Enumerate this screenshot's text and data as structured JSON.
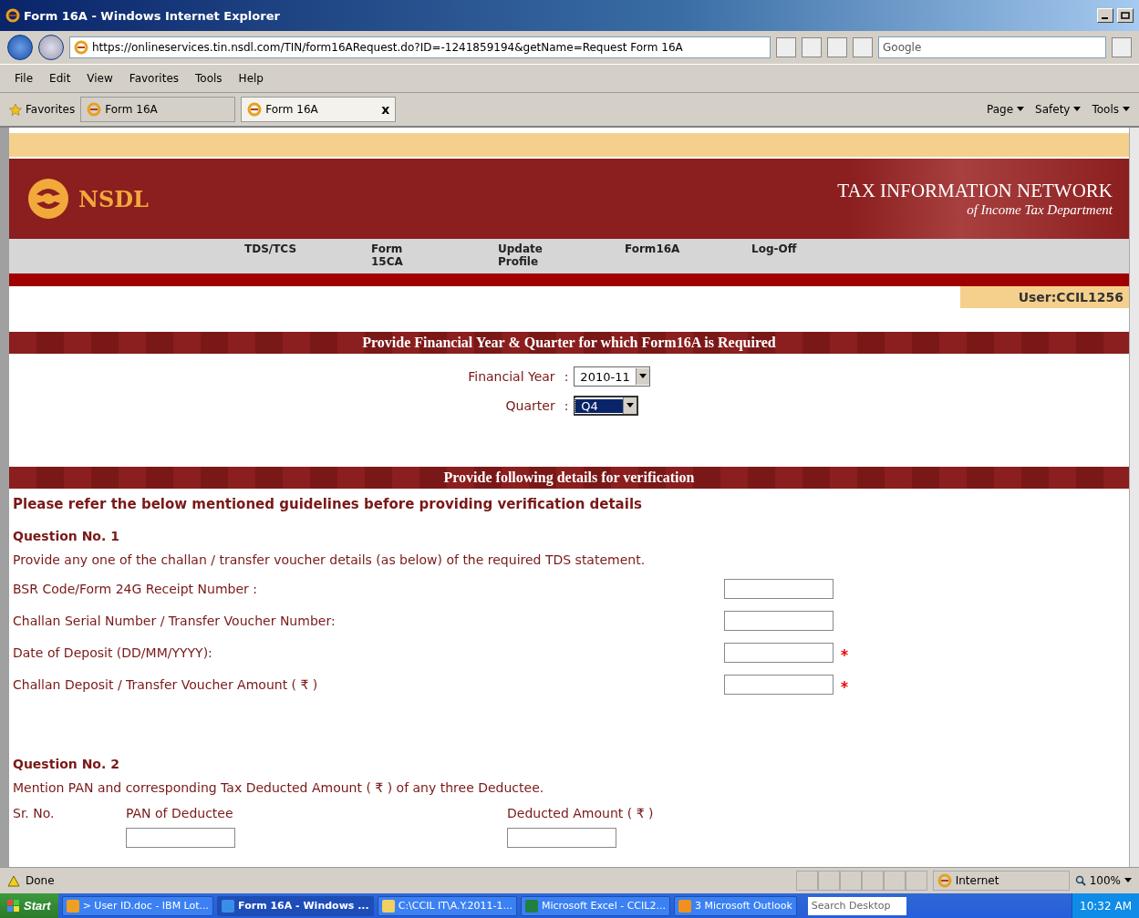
{
  "window": {
    "title": "Form 16A - Windows Internet Explorer"
  },
  "browser": {
    "address": "https://onlineservices.tin.nsdl.com/TIN/form16ARequest.do?ID=-1241859194&getName=Request Form 16A",
    "search_placeholder": "Google",
    "menu": [
      "File",
      "Edit",
      "View",
      "Favorites",
      "Tools",
      "Help"
    ],
    "favorites_label": "Favorites",
    "tabs": [
      {
        "label": "Form 16A",
        "selected": false
      },
      {
        "label": "Form 16A",
        "selected": true,
        "close": "x"
      }
    ],
    "commands": [
      "Page",
      "Safety",
      "Tools"
    ]
  },
  "header": {
    "logo": "NSDL",
    "title": "TAX INFORMATION NETWORK",
    "subtitle": "of Income Tax Department"
  },
  "nav": [
    {
      "lines": [
        "TDS/TCS"
      ]
    },
    {
      "lines": [
        "Form",
        "15CA"
      ]
    },
    {
      "lines": [
        "Update",
        "Profile"
      ]
    },
    {
      "lines": [
        "Form16A"
      ]
    },
    {
      "lines": [
        "Log-Off"
      ]
    }
  ],
  "user": "User:CCIL1256",
  "period": {
    "heading": "Provide Financial Year & Quarter for which Form16A is Required",
    "fields": [
      {
        "label": "Financial Year",
        "colon": ":",
        "value": "2010-11",
        "selected": false
      },
      {
        "label": "Quarter",
        "colon": ":",
        "value": "Q4",
        "selected": true
      }
    ]
  },
  "verification": {
    "heading": "Provide following details for verification",
    "note": "Please refer the below mentioned guidelines before providing verification details",
    "question1": {
      "title": "Question No. 1",
      "text": "Provide any one of the challan / transfer voucher details (as below) of the required TDS statement.",
      "fields": [
        {
          "label": "BSR Code/Form 24G Receipt Number :",
          "required": false
        },
        {
          "label": "Challan Serial Number / Transfer Voucher Number:",
          "required": false
        },
        {
          "label": "Date of Deposit (DD/MM/YYYY):",
          "required": true
        },
        {
          "label": "Challan Deposit / Transfer Voucher Amount ( ₹ )",
          "required": true
        }
      ]
    },
    "question2": {
      "title": "Question No. 2",
      "text": "Mention PAN and corresponding Tax Deducted Amount ( ₹ ) of any three Deductee.",
      "columns": [
        "Sr. No.",
        "PAN of Deductee",
        "Deducted Amount ( ₹ )"
      ]
    }
  },
  "status_bar": {
    "text": "Done",
    "zone": "Internet",
    "zoom": "100%"
  },
  "taskbar": {
    "start": "Start",
    "items": [
      {
        "label": "> User ID.doc - IBM Lot...",
        "selected": false
      },
      {
        "label": "Form 16A - Windows ...",
        "selected": true
      },
      {
        "label": "C:\\CCIL IT\\A.Y.2011-1...",
        "selected": false
      },
      {
        "label": "Microsoft Excel - CCIL2...",
        "selected": false
      },
      {
        "label": "3 Microsoft Outlook",
        "selected": false
      }
    ],
    "search_placeholder": "Search Desktop",
    "clock": "10:32 AM"
  }
}
